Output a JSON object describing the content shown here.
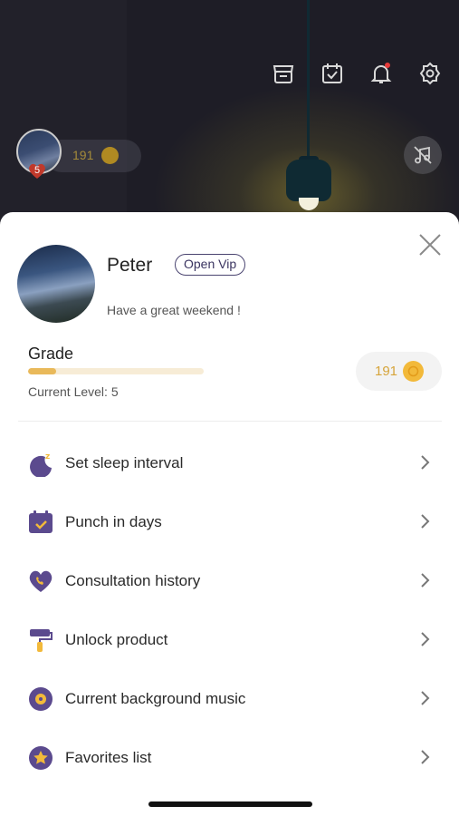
{
  "header": {
    "icons": [
      "store-icon",
      "calendar-check-icon",
      "bell-icon",
      "gear-icon"
    ],
    "mini_profile": {
      "badge_value": "5",
      "coins": "191"
    }
  },
  "profile": {
    "name": "Peter",
    "vip_label": "Open Vip",
    "greeting": "Have a great weekend !",
    "grade_label": "Grade",
    "level_prefix": "Current Level: ",
    "level_value": "5",
    "grade_progress": 0.16,
    "coins": "191"
  },
  "menu": {
    "items": [
      {
        "label": "Set sleep interval",
        "icon": "moon-icon"
      },
      {
        "label": "Punch in days",
        "icon": "calendar-check-icon"
      },
      {
        "label": "Consultation history",
        "icon": "heart-phone-icon"
      },
      {
        "label": "Unlock product",
        "icon": "paint-roller-icon"
      },
      {
        "label": "Current background music",
        "icon": "music-disc-icon"
      },
      {
        "label": "Favorites list",
        "icon": "star-icon"
      }
    ]
  },
  "colors": {
    "accent_purple": "#5b4a8e",
    "accent_yellow": "#f2b93a",
    "progress_track": "#f7ecd6",
    "progress_fill": "#e9b95a"
  }
}
